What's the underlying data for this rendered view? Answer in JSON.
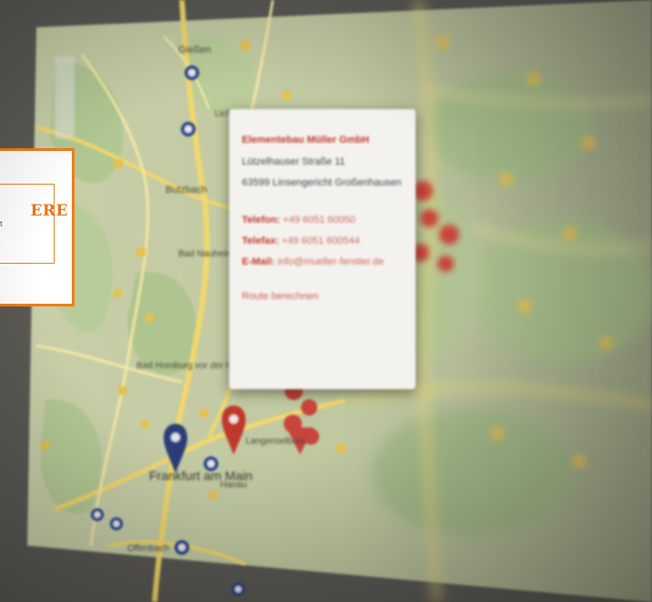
{
  "brand": {
    "word": "ERE",
    "sub": "t",
    "accent_color": "#f07d18"
  },
  "popup": {
    "title": "Elementebau Müller GmbH",
    "street": "Lützelhauser Straße 11",
    "city": "63599 Linsengericht Großenhausen",
    "phone1_label": "Telefon:",
    "phone1_value": "+49 6051 60050",
    "phone2_label": "Telefax:",
    "phone2_value": "+49 6051 600544",
    "email_label": "E-Mail:",
    "email_value": "info@mueller-fenster.de",
    "route_link": "Route berechnen",
    "accent_color": "#c0392b"
  },
  "map": {
    "labels": {
      "gelnhausen": "Gießen",
      "butzbach": "Butzbach",
      "bad_nauheim": "Bad Nauheim",
      "bad_homburg": "Bad Homburg vor der Höhe",
      "frankfurt": "Frankfurt am Main",
      "hanau": "Hanau",
      "offenbach": "Offenbach",
      "lich": "Lich",
      "langenselbold": "Langenselbold"
    },
    "marker_colors": {
      "company": "#c0392b",
      "city": "#2c3e7a",
      "highway": "#1f3f8f"
    }
  }
}
